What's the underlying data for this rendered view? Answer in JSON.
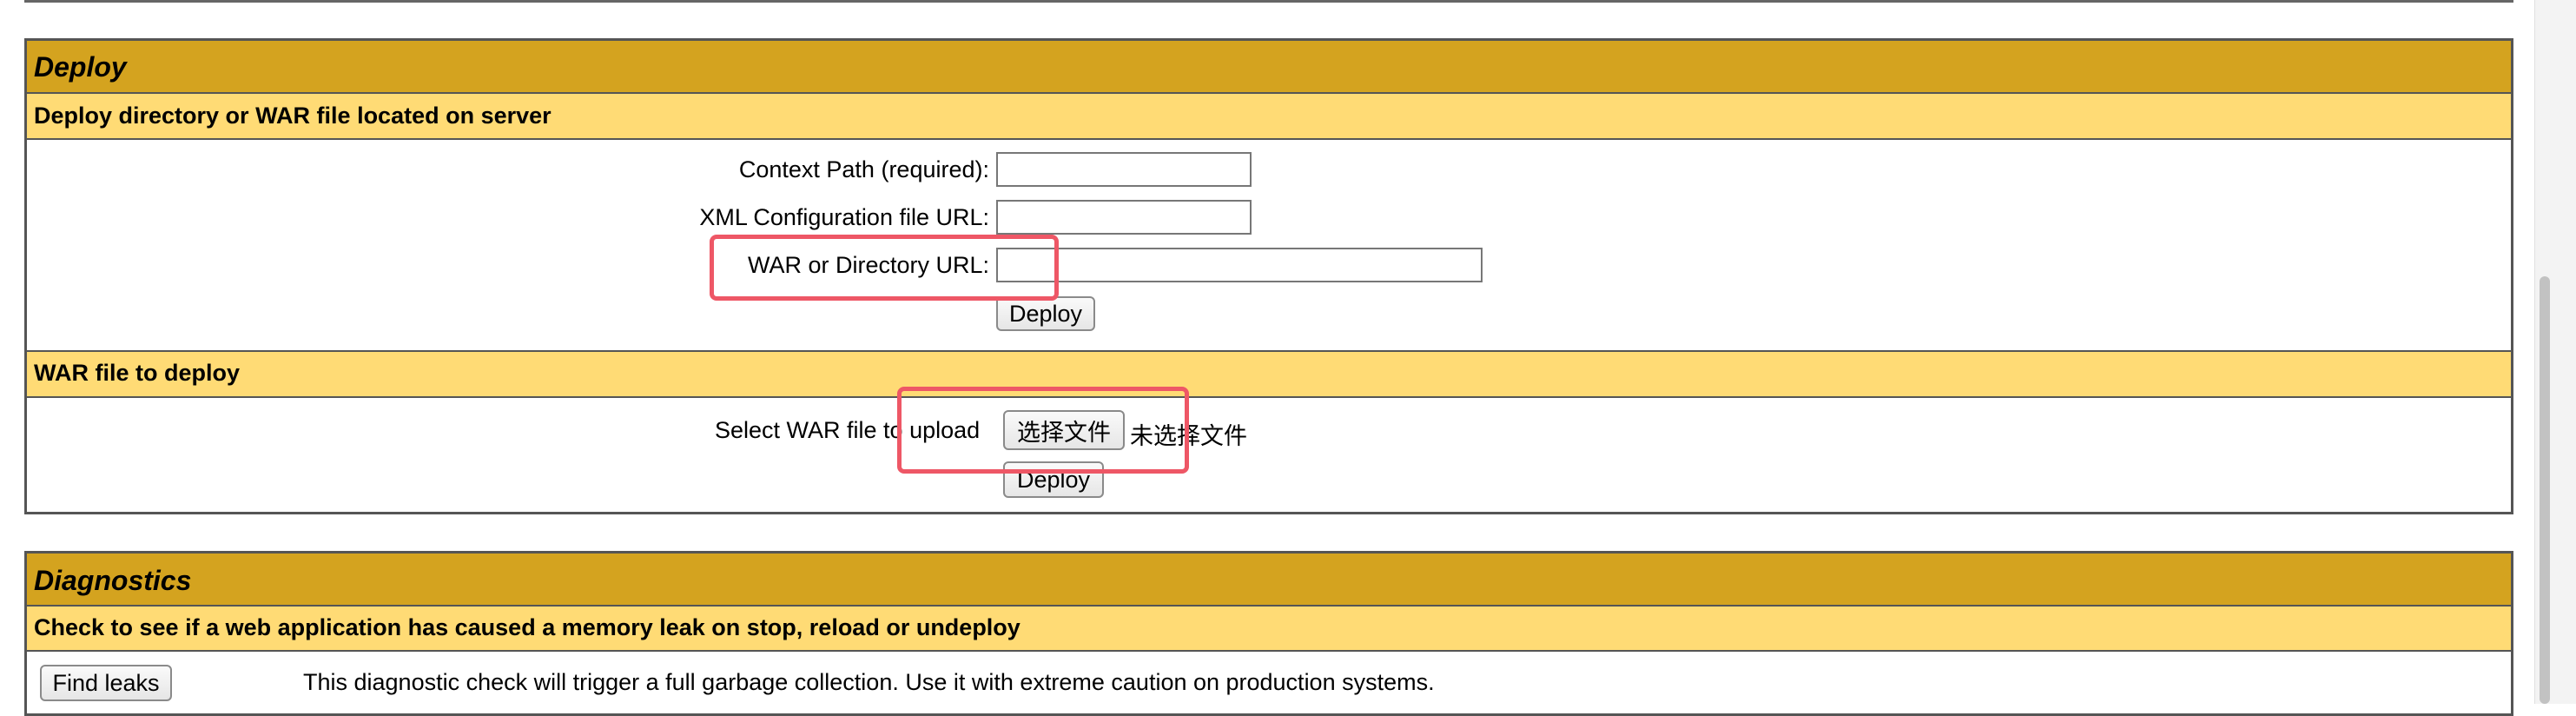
{
  "deploy": {
    "title": "Deploy",
    "server_section": {
      "header": "Deploy directory or WAR file located on server",
      "context_path_label": "Context Path (required):",
      "context_path_value": "",
      "xml_config_label": "XML Configuration file URL:",
      "xml_config_value": "",
      "war_dir_label": "WAR or Directory URL:",
      "war_dir_value": "",
      "deploy_button": "Deploy"
    },
    "upload_section": {
      "header": "WAR file to deploy",
      "select_label": "Select WAR file to upload",
      "choose_file_button": "选择文件",
      "no_file_text": "未选择文件",
      "deploy_button": "Deploy"
    }
  },
  "diagnostics": {
    "title": "Diagnostics",
    "header": "Check to see if a web application has caused a memory leak on stop, reload or undeploy",
    "find_leaks_button": "Find leaks",
    "find_leaks_description": "This diagnostic check will trigger a full garbage collection. Use it with extreme caution on production systems."
  },
  "highlight_color": "#ee5766",
  "colors": {
    "title_bg": "#d4a31f",
    "subheader_bg": "#ffdb75"
  }
}
